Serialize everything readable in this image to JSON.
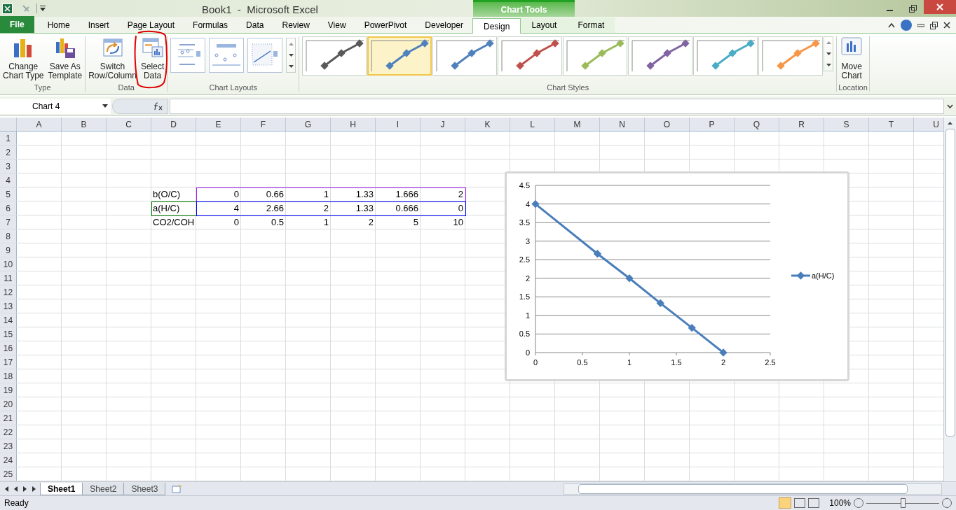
{
  "window": {
    "title": "Book1  -  Microsoft Excel",
    "context_tab": "Chart Tools"
  },
  "tabs": [
    {
      "label": "File",
      "kind": "file",
      "selected": false
    },
    {
      "label": "Home",
      "kind": "main",
      "selected": false
    },
    {
      "label": "Insert",
      "kind": "main",
      "selected": false
    },
    {
      "label": "Page Layout",
      "kind": "main",
      "selected": false
    },
    {
      "label": "Formulas",
      "kind": "main",
      "selected": false
    },
    {
      "label": "Data",
      "kind": "main",
      "selected": false
    },
    {
      "label": "Review",
      "kind": "main",
      "selected": false
    },
    {
      "label": "View",
      "kind": "main",
      "selected": false
    },
    {
      "label": "PowerPivot",
      "kind": "main",
      "selected": false
    },
    {
      "label": "Developer",
      "kind": "main",
      "selected": false
    },
    {
      "label": "Design",
      "kind": "context",
      "selected": true
    },
    {
      "label": "Layout",
      "kind": "context",
      "selected": false
    },
    {
      "label": "Format",
      "kind": "context",
      "selected": false
    }
  ],
  "ribbon": {
    "groups": [
      {
        "label": "Type",
        "buttons": [
          {
            "lines": [
              "Change",
              "Chart Type"
            ],
            "kind": "chart_type"
          },
          {
            "lines": [
              "Save As",
              "Template"
            ],
            "kind": "template"
          }
        ]
      },
      {
        "label": "Data",
        "buttons": [
          {
            "lines": [
              "Switch",
              "Row/Column"
            ],
            "kind": "switch"
          },
          {
            "lines": [
              "Select",
              "Data"
            ],
            "kind": "select_data"
          }
        ]
      }
    ],
    "layouts_label": "Chart Layouts",
    "styles_label": "Chart Styles",
    "chart_styles": [
      {
        "color": "#595959",
        "selected": false
      },
      {
        "color": "#4f81bd",
        "selected": true
      },
      {
        "color": "#4f81bd",
        "selected": false
      },
      {
        "color": "#c0504d",
        "selected": false
      },
      {
        "color": "#9bbb59",
        "selected": false
      },
      {
        "color": "#8064a2",
        "selected": false
      },
      {
        "color": "#4bacc6",
        "selected": false
      },
      {
        "color": "#f79646",
        "selected": false
      }
    ],
    "location": {
      "label": "Location",
      "button_lines": [
        "Move",
        "Chart"
      ]
    }
  },
  "formula_bar": {
    "name_box": "Chart 4"
  },
  "columns": [
    "A",
    "B",
    "C",
    "D",
    "E",
    "F",
    "G",
    "H",
    "I",
    "J",
    "K",
    "L",
    "M",
    "N",
    "O",
    "P",
    "Q",
    "R",
    "S",
    "T",
    "U"
  ],
  "rows": [
    "1",
    "2",
    "3",
    "4",
    "5",
    "6",
    "7",
    "8",
    "9",
    "10",
    "11",
    "12",
    "13",
    "14",
    "15",
    "16",
    "17",
    "18",
    "19",
    "20",
    "21",
    "22",
    "23",
    "24",
    "25"
  ],
  "table": [
    {
      "label": "b(O/C)",
      "values": [
        "0",
        "0.66",
        "1",
        "1.33",
        "1.666",
        "2"
      ]
    },
    {
      "label": "a(H/C)",
      "values": [
        "4",
        "2.66",
        "2",
        "1.33",
        "0.666",
        "0"
      ]
    },
    {
      "label": "CO2/COH",
      "values": [
        "0",
        "0.5",
        "1",
        "2",
        "5",
        "10"
      ]
    }
  ],
  "highlights": [
    {
      "kind": "x_values",
      "color": "#a020f0"
    },
    {
      "kind": "series_name",
      "color": "#008000"
    },
    {
      "kind": "y_values",
      "color": "#0000ff"
    }
  ],
  "chart": {
    "chart_data": {
      "type": "line",
      "x": [
        0,
        0.66,
        1,
        1.33,
        1.666,
        2
      ],
      "grid": true,
      "series": [
        {
          "name": "a(H/C)",
          "color": "#4a7ebb",
          "marker": "diamond",
          "values": [
            4,
            2.66,
            2,
            1.33,
            0.666,
            0
          ]
        }
      ],
      "xlim": [
        0,
        2.5
      ],
      "ylim": [
        0,
        4.5
      ],
      "xticks": [
        0,
        0.5,
        1,
        1.5,
        2,
        2.5
      ],
      "yticks": [
        0,
        0.5,
        1,
        1.5,
        2,
        2.5,
        3,
        3.5,
        4,
        4.5
      ]
    }
  },
  "sheets": [
    {
      "label": "Sheet1",
      "selected": true
    },
    {
      "label": "Sheet2",
      "selected": false
    },
    {
      "label": "Sheet3",
      "selected": false
    }
  ],
  "status_bar": {
    "status": "Ready",
    "zoom": "100%",
    "zoom_slider": {
      "level": 0.5
    }
  }
}
